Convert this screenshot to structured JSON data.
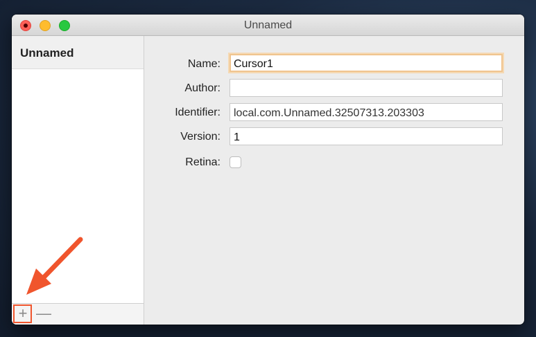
{
  "window": {
    "title": "Unnamed"
  },
  "sidebar": {
    "header": "Unnamed",
    "add_glyph": "+",
    "remove_glyph": "—"
  },
  "form": {
    "name_label": "Name:",
    "name_value": "Cursor1",
    "author_label": "Author:",
    "author_value": "",
    "identifier_label": "Identifier:",
    "identifier_value": "local.com.Unnamed.32507313.203303",
    "version_label": "Version:",
    "version_value": "1",
    "retina_label": "Retina:"
  },
  "colors": {
    "annotation": "#f0552d",
    "focus_ring": "#f0c48e"
  }
}
